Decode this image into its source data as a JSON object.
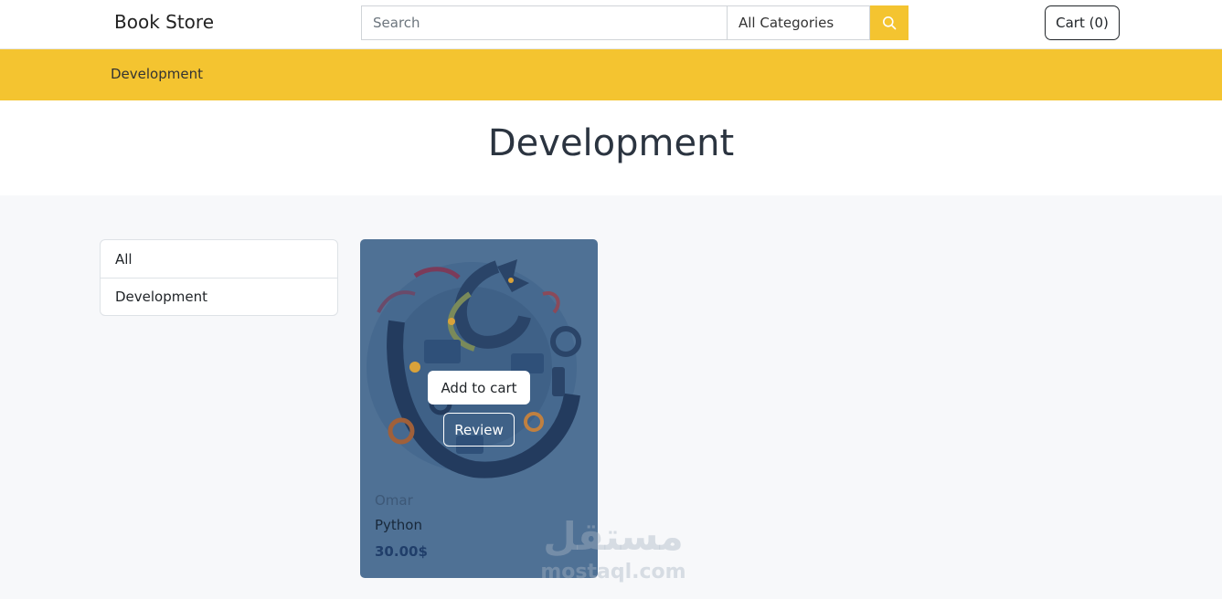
{
  "navbar": {
    "brand": "Book Store",
    "search_placeholder": "Search",
    "category_selected": "All Categories",
    "search_icon": "search-icon",
    "cart_label": "Cart (0)"
  },
  "breadcrumb": {
    "current": "Development"
  },
  "page": {
    "title": "Development"
  },
  "sidebar": {
    "items": [
      {
        "label": "All"
      },
      {
        "label": "Development"
      }
    ]
  },
  "products": [
    {
      "cover_icon": "python-dragon-illustration",
      "add_to_cart_label": "Add to cart",
      "review_label": "Review",
      "author": "Omar",
      "title": "Python",
      "price": "30.00$"
    }
  ],
  "watermark": {
    "arabic": "مستقل",
    "latin": "mostaql.com"
  },
  "colors": {
    "accent": "#f4c430",
    "card_overlay": "#4f7195",
    "background": "#f7f8fa"
  }
}
